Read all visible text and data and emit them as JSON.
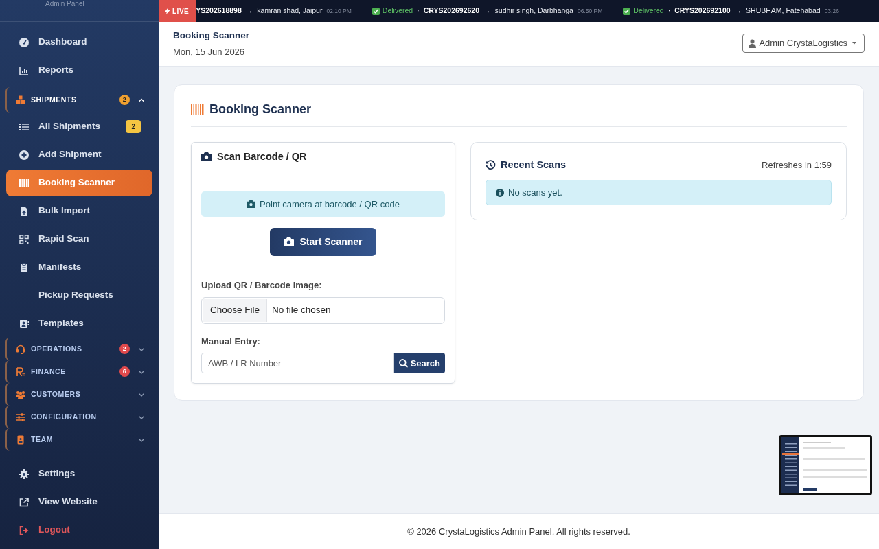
{
  "sidebar": {
    "brand_subtitle": "Admin Panel",
    "items": [
      {
        "kind": "link",
        "label": "Dashboard",
        "selected": false
      },
      {
        "kind": "link",
        "label": "Reports",
        "selected": false
      },
      {
        "kind": "group",
        "label": "SHIPMENTS",
        "badge": "2",
        "color": "#f0a030",
        "expanded": true,
        "children": [
          {
            "kind": "link",
            "label": "All Shipments",
            "selected": false,
            "badge": "2"
          },
          {
            "kind": "link",
            "label": "Add Shipment",
            "selected": false
          },
          {
            "kind": "link",
            "label": "Booking Scanner",
            "selected": true
          },
          {
            "kind": "link",
            "label": "Bulk Import",
            "selected": false
          },
          {
            "kind": "link",
            "label": "Rapid Scan",
            "selected": false
          },
          {
            "kind": "link",
            "label": "Manifests",
            "selected": false
          },
          {
            "kind": "link",
            "label": "Pickup Requests",
            "selected": false
          },
          {
            "kind": "link",
            "label": "Templates",
            "selected": false
          }
        ]
      },
      {
        "kind": "group",
        "label": "OPERATIONS",
        "badge": "2",
        "color": "#e0494c",
        "expanded": false
      },
      {
        "kind": "group",
        "label": "FINANCE",
        "badge": "6",
        "color": "#e0494c",
        "expanded": false
      },
      {
        "kind": "group",
        "label": "CUSTOMERS",
        "expanded": false
      },
      {
        "kind": "group",
        "label": "CONFIGURATION",
        "expanded": false
      },
      {
        "kind": "group",
        "label": "TEAM",
        "expanded": false
      },
      {
        "kind": "link",
        "label": "Settings",
        "selected": false
      },
      {
        "kind": "link",
        "label": "View Website",
        "selected": false
      },
      {
        "kind": "logout",
        "label": "Logout",
        "selected": false
      }
    ]
  },
  "ticker": {
    "badge": "LIVE",
    "items": [
      {
        "awb": "YS202618898",
        "arrow": "→",
        "consignee": "kamran shad, Jaipur",
        "time": "02:10 PM"
      },
      {
        "status": "Delivered",
        "separator": "·",
        "awb": "CRYS202692620",
        "arrow": "→",
        "consignee": "sudhir singh, Darbhanga",
        "time": "06:50 PM"
      },
      {
        "status": "Delivered",
        "separator": "·",
        "awb": "CRYS202692100",
        "arrow": "→",
        "consignee": "SHUBHAM, Fatehabad",
        "time": "03:26"
      }
    ]
  },
  "header": {
    "title": "Booking Scanner",
    "date": "Mon, 15 Jun 2026",
    "user_menu": "Admin CrystaLogistics"
  },
  "page": {
    "title": "Booking Scanner",
    "scan_card": {
      "title": "Scan Barcode / QR",
      "hint": "Point camera at barcode / QR code",
      "start_button": "Start Scanner",
      "upload_label": "Upload QR / Barcode Image:",
      "file_button": "Choose File",
      "file_status": "No file chosen",
      "manual_label": "Manual Entry:",
      "manual_placeholder": "AWB / LR Number",
      "search_button": "Search"
    },
    "recent_card": {
      "title": "Recent Scans",
      "refresh": "Refreshes in 1:59",
      "empty": "No scans yet."
    }
  },
  "footer": "© 2026 CrystaLogistics Admin Panel. All rights reserved."
}
